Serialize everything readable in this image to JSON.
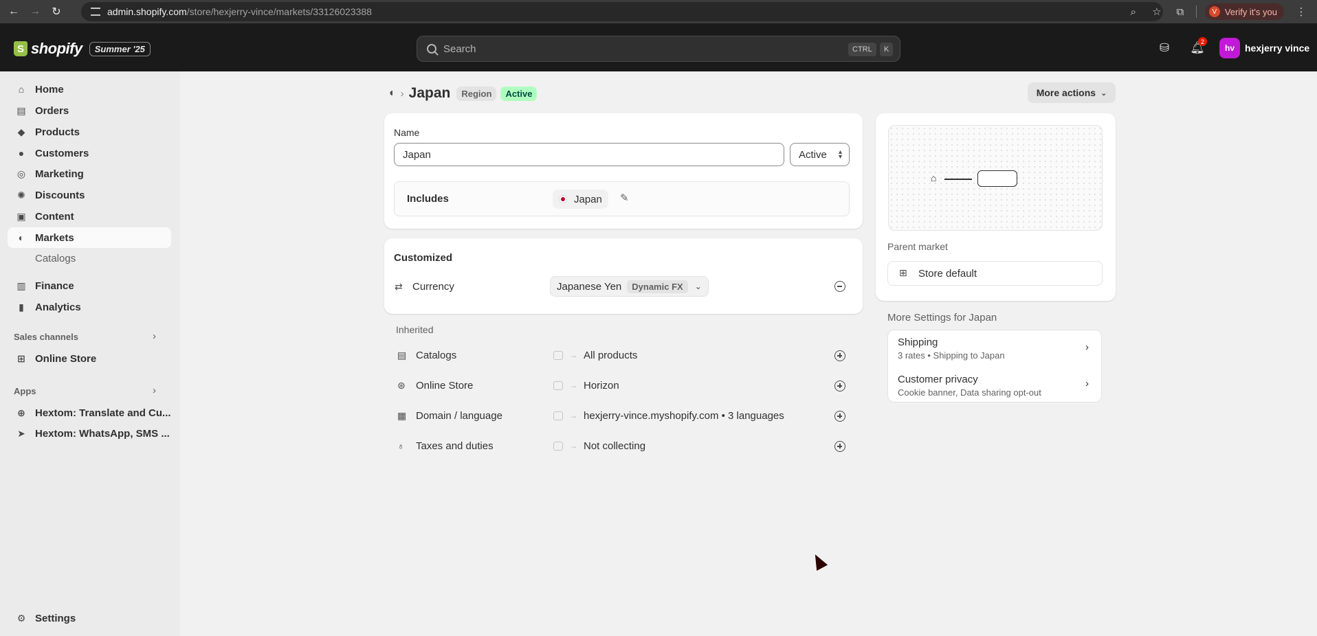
{
  "browser": {
    "url_host": "admin.shopify.com",
    "url_path": "/store/hexjerry-vince/markets/33126023388",
    "verify_label": "Verify it's you",
    "verify_avatar": "V"
  },
  "topbar": {
    "logo_text": "shopify",
    "logo_mark": "S",
    "edition_badge": "Summer '25",
    "search_placeholder": "Search",
    "shortcut_ctrl": "CTRL",
    "shortcut_k": "K",
    "notification_count": "2",
    "user_initials": "hv",
    "user_name": "hexjerry vince"
  },
  "sidebar": {
    "home": "Home",
    "orders": "Orders",
    "products": "Products",
    "customers": "Customers",
    "marketing": "Marketing",
    "discounts": "Discounts",
    "content": "Content",
    "markets": "Markets",
    "catalogs": "Catalogs",
    "finance": "Finance",
    "analytics": "Analytics",
    "sales_channels": "Sales channels",
    "online_store": "Online Store",
    "apps": "Apps",
    "app1": "Hextom: Translate and Cu...",
    "app2": "Hextom: WhatsApp, SMS ...",
    "settings": "Settings"
  },
  "header": {
    "title": "Japan",
    "type_badge": "Region",
    "status_badge": "Active",
    "more_actions": "More actions"
  },
  "name_card": {
    "name_label": "Name",
    "name_value": "Japan",
    "status_value": "Active",
    "includes_label": "Includes",
    "includes_country": "Japan"
  },
  "customized": {
    "heading": "Customized",
    "currency_label": "Currency",
    "currency_value": "Japanese Yen",
    "currency_badge": "Dynamic FX"
  },
  "inherited": {
    "heading": "Inherited",
    "rows": [
      {
        "label": "Catalogs",
        "value": "All products"
      },
      {
        "label": "Online Store",
        "value": "Horizon"
      },
      {
        "label": "Domain / language",
        "value": "hexjerry-vince.myshopify.com • 3 languages"
      },
      {
        "label": "Taxes and duties",
        "value": "Not collecting"
      }
    ]
  },
  "parent": {
    "label": "Parent market",
    "value": "Store default"
  },
  "more_settings": {
    "heading": "More Settings for Japan",
    "shipping_title": "Shipping",
    "shipping_sub": "3 rates • Shipping to Japan",
    "privacy_title": "Customer privacy",
    "privacy_sub": "Cookie banner, Data sharing opt-out"
  }
}
